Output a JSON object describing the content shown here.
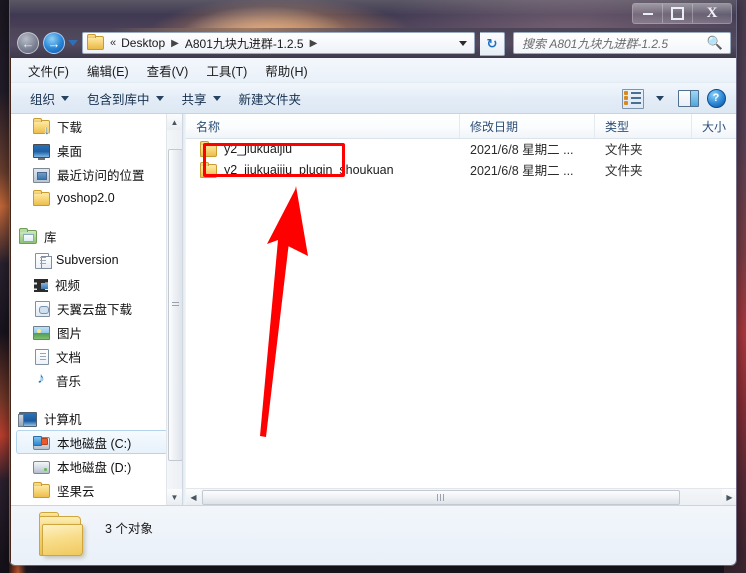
{
  "window": {
    "controls": {
      "minimize": "–",
      "maximize": "□",
      "close": "X"
    }
  },
  "navigation": {
    "back_icon": "←",
    "forward_icon": "→",
    "history_dropdown_icon": "chevron-down-icon",
    "breadcrumb": {
      "folder_icon": "folder-icon",
      "overflow": "«",
      "items": [
        "Desktop",
        "A801九块九进群-1.2.5"
      ],
      "separator": "▶",
      "dropdown_icon": "▾"
    },
    "refresh_icon": "↻"
  },
  "search": {
    "placeholder": "搜索 A801九块九进群-1.2.5",
    "icon": "search-icon"
  },
  "menubar": {
    "items": [
      "文件(F)",
      "编辑(E)",
      "查看(V)",
      "工具(T)",
      "帮助(H)"
    ]
  },
  "toolbar": {
    "items": [
      {
        "label": "组织",
        "has_caret": true
      },
      {
        "label": "包含到库中",
        "has_caret": true
      },
      {
        "label": "共享",
        "has_caret": true
      },
      {
        "label": "新建文件夹",
        "has_caret": false
      }
    ],
    "right_icons": [
      "view-options-icon",
      "view-dropdown-icon",
      "preview-pane-icon",
      "help-icon"
    ],
    "help_glyph": "?"
  },
  "sidebar": {
    "favorites": [
      {
        "label": "下载",
        "icon": "download-folder-icon"
      },
      {
        "label": "桌面",
        "icon": "desktop-icon"
      },
      {
        "label": "最近访问的位置",
        "icon": "recent-places-icon"
      },
      {
        "label": "yoshop2.0",
        "icon": "folder-icon"
      }
    ],
    "libraries_root": {
      "label": "库",
      "icon": "library-icon"
    },
    "libraries": [
      {
        "label": "Subversion",
        "icon": "subversion-icon"
      },
      {
        "label": "视频",
        "icon": "video-icon"
      },
      {
        "label": "天翼云盘下载",
        "icon": "cloud-drive-icon"
      },
      {
        "label": "图片",
        "icon": "pictures-icon"
      },
      {
        "label": "文档",
        "icon": "documents-icon"
      },
      {
        "label": "音乐",
        "icon": "music-icon"
      }
    ],
    "computer_root": {
      "label": "计算机",
      "icon": "computer-icon"
    },
    "drives": [
      {
        "label": "本地磁盘 (C:)",
        "icon": "system-drive-icon",
        "selected": true
      },
      {
        "label": "本地磁盘 (D:)",
        "icon": "hard-drive-icon",
        "selected": false
      },
      {
        "label": "坚果云",
        "icon": "folder-icon",
        "selected": false
      }
    ]
  },
  "filelist": {
    "columns": [
      "名称",
      "修改日期",
      "类型",
      "大小"
    ],
    "rows": [
      {
        "name": "y2_jiukuaijiu",
        "date": "2021/6/8 星期二 ...",
        "type": "文件夹",
        "size": "",
        "icon": "folder-icon"
      },
      {
        "name": "y2_jiukuaijiu_plugin_shoukuan",
        "date": "2021/6/8 星期二 ...",
        "type": "文件夹",
        "size": "",
        "icon": "folder-icon"
      }
    ]
  },
  "statusbar": {
    "count_text": "3 个对象",
    "icon": "large-folder-icon"
  },
  "annotation": {
    "highlight_color": "#fe0000",
    "box_target": "y2_jiukuaijiu",
    "arrow": "red-arrow-pointing-up"
  }
}
